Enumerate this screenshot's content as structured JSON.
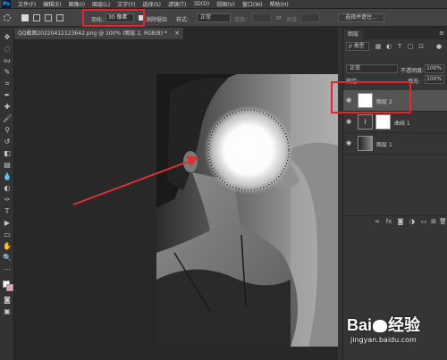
{
  "menubar": {
    "logo": "Ps",
    "items": [
      "文件(F)",
      "编辑(E)",
      "图像(I)",
      "图层(L)",
      "文字(Y)",
      "选择(S)",
      "滤镜(T)",
      "3D(D)",
      "视图(V)",
      "窗口(W)",
      "帮助(H)"
    ]
  },
  "options": {
    "feather_label": "羽化:",
    "feather_value": "30 像素",
    "antialias_label": "消除锯齿",
    "style_label": "样式:",
    "style_value": "正常",
    "width_label": "宽度:",
    "height_label": "高度:",
    "select_mask_label": "选择并遮住..."
  },
  "document": {
    "tab_title": "QQ截图20220412123642.png @ 100% (图层 2, RGB/8) *",
    "close_glyph": "×"
  },
  "layers_panel": {
    "tab_label": "图层",
    "filter_label": "ρ 类型",
    "blend_mode": "正常",
    "opacity_label": "不透明度:",
    "opacity_value": "100%",
    "lock_label": "锁定:",
    "fill_label": "填充:",
    "fill_value": "100%",
    "layers": [
      {
        "name": "图层 2",
        "selected": true
      },
      {
        "name": "曲线 1",
        "selected": false
      },
      {
        "name": "图层 1",
        "selected": false
      }
    ]
  },
  "watermark": {
    "brand": "Bai",
    "brand_suffix": "经验",
    "url": "jingyan.baidu.com"
  },
  "colors": {
    "highlight": "#e8232d",
    "arrow": "#e03030",
    "selection_fill": "#ffffff"
  }
}
